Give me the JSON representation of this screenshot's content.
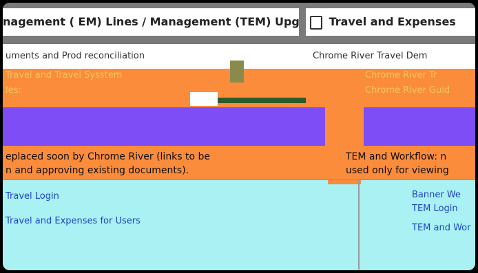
{
  "tabs": [
    {
      "label": "nagement ( EM) Lines / Management (TEM) Upgra"
    },
    {
      "label": "Travel and Expenses"
    }
  ],
  "address": {
    "left_text": "uments and Prod reconciliation",
    "right_text": "Chrome River Travel Dem"
  },
  "left_panel": {
    "heading_link": "Travel and Travel Sysstem",
    "sub_label": "les:",
    "description_line1": "eplaced soon by Chrome River (links to be",
    "description_line2": "n and approving existing documents).",
    "link1": "Travel Login",
    "link2": "Travel and Expenses for Users"
  },
  "right_panel": {
    "heading_link": "Chrome River Tr",
    "sub_link": "Chrome River Guid",
    "description_line1": "TEM and Workflow: n",
    "description_line2": "used only for viewing",
    "link1": "Banner We",
    "link2": "TEM Login",
    "link3": "TEM and Wor"
  },
  "colors": {
    "orange": "#fb8c3c",
    "purple": "#7f4df6",
    "cyan": "#a9f1f2"
  }
}
